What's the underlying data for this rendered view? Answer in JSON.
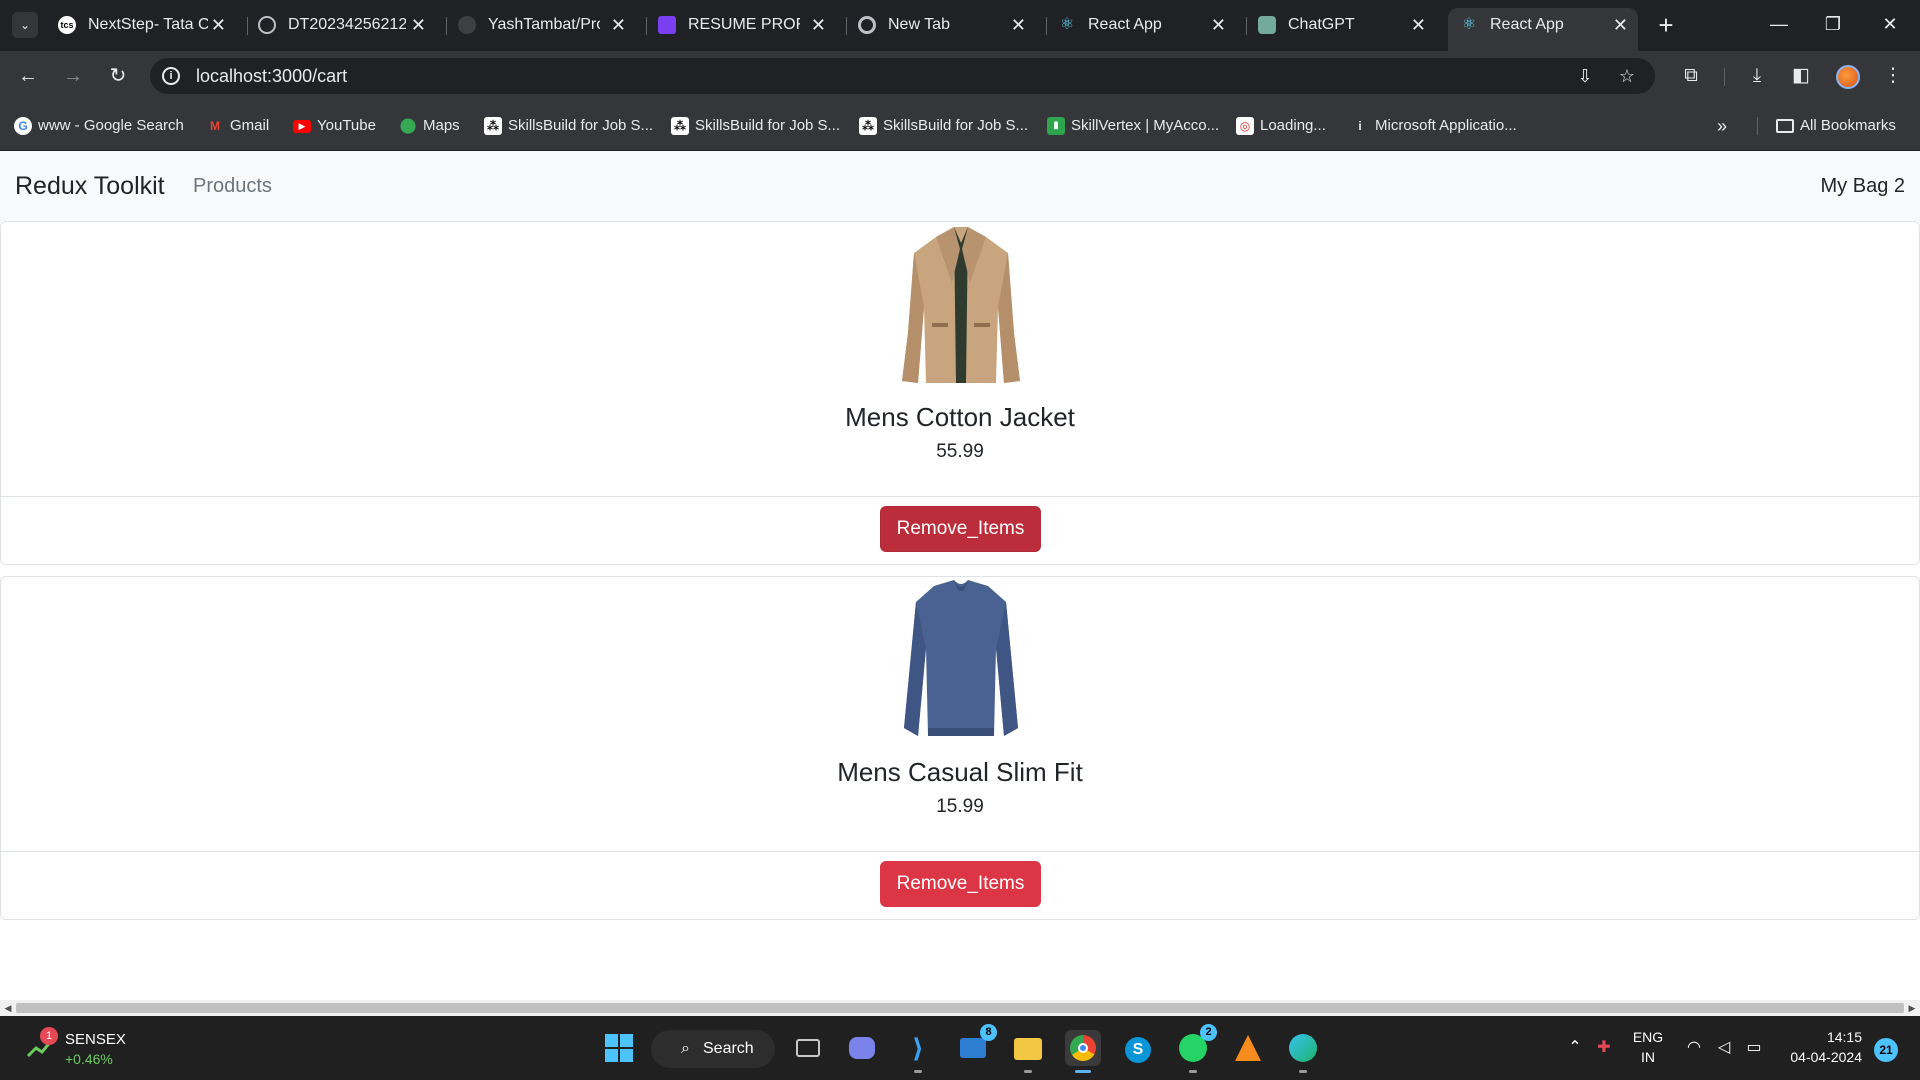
{
  "browser": {
    "tabs": [
      {
        "title": "NextStep- Tata C",
        "favicon": "tcs-icon",
        "color": "#ffffff"
      },
      {
        "title": "DT20234256212...",
        "favicon": "globe-icon",
        "color": "#bdc1c6"
      },
      {
        "title": "YashTambat/Proc",
        "favicon": "github-icon",
        "color": "#3c4043"
      },
      {
        "title": "RESUME PROFILE",
        "favicon": "resume-icon",
        "color": "#7b3ff2"
      },
      {
        "title": "New Tab",
        "favicon": "chrome-icon",
        "color": "#bdc1c6"
      },
      {
        "title": "React App",
        "favicon": "react-icon",
        "color": "#61dafb"
      },
      {
        "title": "ChatGPT",
        "favicon": "chatgpt-icon",
        "color": "#74aa9c"
      },
      {
        "title": "React App",
        "favicon": "react-icon",
        "color": "#61dafb"
      }
    ],
    "url": "localhost:3000/cart",
    "bookmarks": [
      {
        "label": "www - Google Search",
        "icon": "google-icon",
        "color": "#4285f4",
        "glyph": "G"
      },
      {
        "label": "Gmail",
        "icon": "gmail-icon",
        "color": "#ea4335",
        "glyph": "M"
      },
      {
        "label": "YouTube",
        "icon": "youtube-icon",
        "color": "#ff0000",
        "glyph": "▶"
      },
      {
        "label": "Maps",
        "icon": "maps-icon",
        "color": "#34a853",
        "glyph": "⬤"
      },
      {
        "label": "SkillsBuild for Job S...",
        "icon": "skillsbuild-icon",
        "color": "#ffffff",
        "glyph": "⁂"
      },
      {
        "label": "SkillsBuild for Job S...",
        "icon": "skillsbuild-icon",
        "color": "#ffffff",
        "glyph": "⁂"
      },
      {
        "label": "SkillsBuild for Job S...",
        "icon": "skillsbuild-icon",
        "color": "#ffffff",
        "glyph": "⁂"
      },
      {
        "label": "SkillVertex | MyAcco...",
        "icon": "skillvertex-icon",
        "color": "#2ea44f",
        "glyph": "▮"
      },
      {
        "label": "Loading...",
        "icon": "loading-icon",
        "color": "#f28b82",
        "glyph": "◎"
      },
      {
        "label": "Microsoft Applicatio...",
        "icon": "microsoft-icon",
        "color": "#e8eaed",
        "glyph": "i"
      }
    ],
    "all_bookmarks_label": "All Bookmarks"
  },
  "app": {
    "brand": "Redux Toolkit",
    "nav_link": "Products",
    "bag_label": "My Bag 2"
  },
  "cart": {
    "items": [
      {
        "title": "Mens Cotton Jacket",
        "price": "55.99",
        "button": "Remove_Items"
      },
      {
        "title": "Mens Casual Slim Fit",
        "price": "15.99",
        "button": "Remove_Items"
      }
    ]
  },
  "taskbar": {
    "widget_title": "SENSEX",
    "widget_value": "+0.46%",
    "widget_badge": "1",
    "search_label": "Search",
    "mail_badge": "8",
    "whatsapp_badge": "2",
    "lang_top": "ENG",
    "lang_bottom": "IN",
    "time": "14:15",
    "date": "04-04-2024",
    "notifications": "21"
  }
}
